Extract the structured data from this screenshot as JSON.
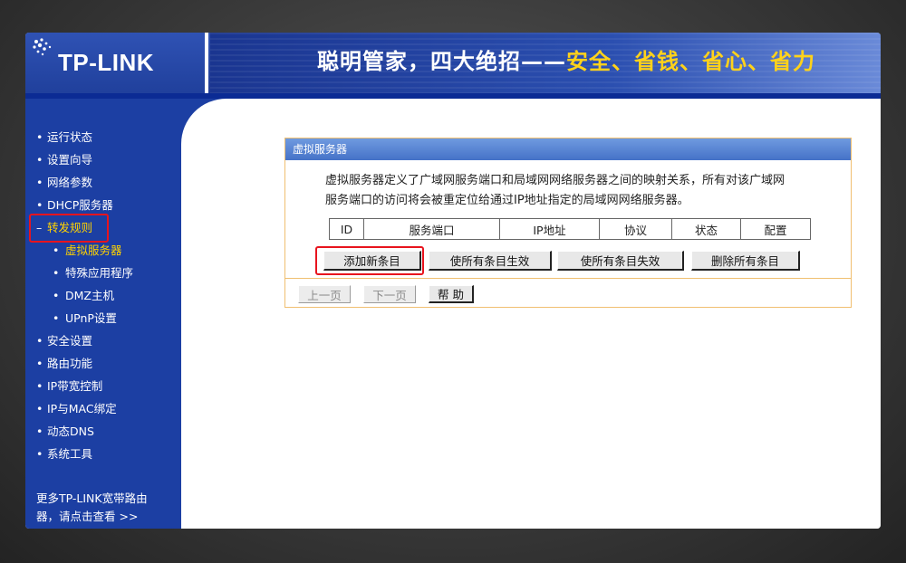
{
  "header": {
    "logo": "TP-LINK",
    "slogan_main": "聪明管家，四大绝招",
    "slogan_dash": "——",
    "slogan_highlight": "安全、省钱、省心、省力"
  },
  "sidebar": {
    "items": [
      {
        "label": "运行状态",
        "bullet": "•"
      },
      {
        "label": "设置向导",
        "bullet": "•"
      },
      {
        "label": "网络参数",
        "bullet": "•"
      },
      {
        "label": "DHCP服务器",
        "bullet": "•"
      },
      {
        "label": "转发规则",
        "bullet": "–"
      },
      {
        "label": "虚拟服务器",
        "bullet": "•"
      },
      {
        "label": "特殊应用程序",
        "bullet": "•"
      },
      {
        "label": "DMZ主机",
        "bullet": "•"
      },
      {
        "label": "UPnP设置",
        "bullet": "•"
      },
      {
        "label": "安全设置",
        "bullet": "•"
      },
      {
        "label": "路由功能",
        "bullet": "•"
      },
      {
        "label": "IP带宽控制",
        "bullet": "•"
      },
      {
        "label": "IP与MAC绑定",
        "bullet": "•"
      },
      {
        "label": "动态DNS",
        "bullet": "•"
      },
      {
        "label": "系统工具",
        "bullet": "•"
      }
    ],
    "more_line1": "更多TP-LINK宽带路由",
    "more_line2": "器，请点击查看 >>"
  },
  "panel": {
    "title": "虚拟服务器",
    "description_line1": "虚拟服务器定义了广域网服务端口和局域网网络服务器之间的映射关系，所有对该广域网",
    "description_line2": "服务端口的访问将会被重定位给通过IP地址指定的局域网网络服务器。",
    "columns": [
      "ID",
      "服务端口",
      "IP地址",
      "协议",
      "状态",
      "配置"
    ],
    "buttons": {
      "add": "添加新条目",
      "enable_all": "使所有条目生效",
      "disable_all": "使所有条目失效",
      "delete_all": "删除所有条目"
    },
    "nav": {
      "prev": "上一页",
      "next": "下一页",
      "help": "帮 助"
    }
  },
  "colors": {
    "header_blue": "#1e3a94",
    "sidebar_blue": "#1c3fa3",
    "highlight_red": "#e8141e",
    "slogan_yellow": "#ffd21a",
    "panel_border": "#f0bf70",
    "panel_title": "#4572c8"
  }
}
